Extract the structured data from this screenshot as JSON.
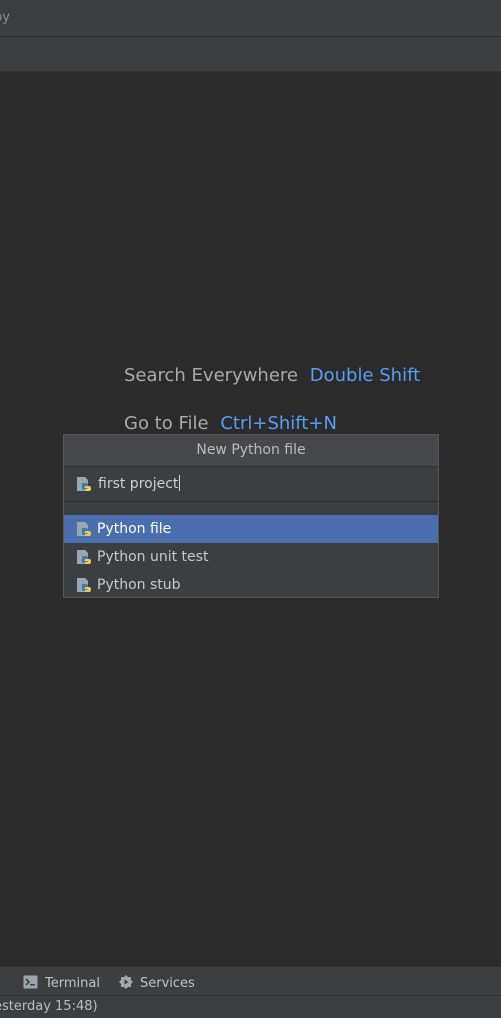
{
  "window": {
    "title_fragment": "py"
  },
  "welcome_hints": [
    {
      "label": "Search Everywhere",
      "shortcut": "Double Shift"
    },
    {
      "label": "Go to File",
      "shortcut": "Ctrl+Shift+N"
    }
  ],
  "new_file_dialog": {
    "title": "New Python file",
    "name_value": "first project",
    "kinds": [
      {
        "label": "Python file",
        "selected": true
      },
      {
        "label": "Python unit test",
        "selected": false
      },
      {
        "label": "Python stub",
        "selected": false
      }
    ]
  },
  "bottom_tabs": [
    {
      "label": "Terminal",
      "icon": "terminal-icon"
    },
    {
      "label": "Services",
      "icon": "services-icon"
    }
  ],
  "status_bar": {
    "text": "esterday 15:48)"
  },
  "colors": {
    "accent": "#589df6",
    "selection": "#4b6eaf",
    "background": "#2b2b2b",
    "panel": "#3c3f41"
  }
}
